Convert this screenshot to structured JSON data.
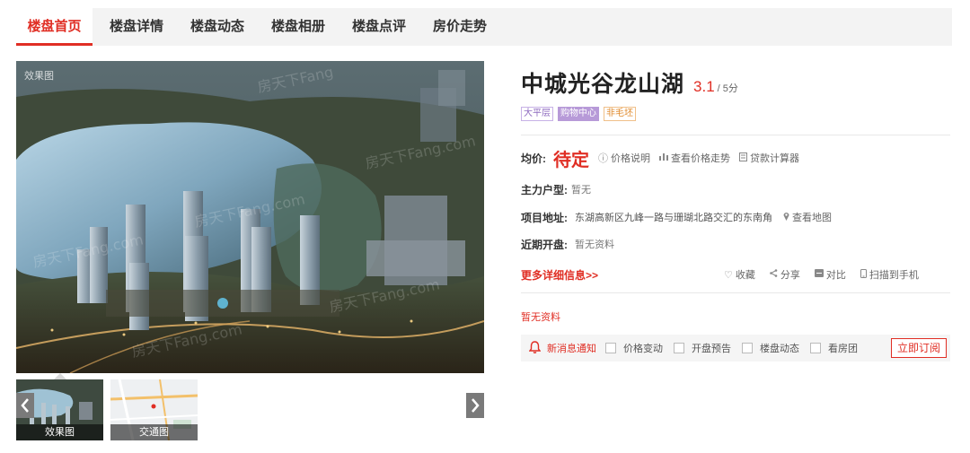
{
  "nav": {
    "tabs": [
      {
        "label": "楼盘首页",
        "active": true
      },
      {
        "label": "楼盘详情",
        "active": false
      },
      {
        "label": "楼盘动态",
        "active": false
      },
      {
        "label": "楼盘相册",
        "active": false
      },
      {
        "label": "楼盘点评",
        "active": false
      },
      {
        "label": "房价走势",
        "active": false
      }
    ]
  },
  "gallery": {
    "main_tag": "效果图",
    "thumbs": [
      {
        "caption": "效果图",
        "selected": true
      },
      {
        "caption": "交通图",
        "selected": false
      }
    ],
    "prev_icon": "chevron-left-icon",
    "next_icon": "chevron-right-icon"
  },
  "info": {
    "title": "中城光谷龙山湖",
    "score": "3.1",
    "score_unit": "/ 5分",
    "tags": [
      "大平层",
      "购物中心",
      "非毛坯"
    ],
    "price_label": "均价:",
    "price_value": "待定",
    "price_links": [
      {
        "label": "价格说明",
        "icon": "info-circle-icon"
      },
      {
        "label": "查看价格走势",
        "icon": "bar-chart-icon"
      },
      {
        "label": "贷款计算器",
        "icon": "calculator-icon"
      }
    ],
    "layout_label": "主力户型:",
    "layout_value": "暂无",
    "address_label": "项目地址:",
    "address_value": "东湖高新区九峰一路与珊瑚北路交汇的东南角",
    "map_link": "查看地图",
    "opening_label": "近期开盘:",
    "opening_value": "暂无资料",
    "more_link": "更多详细信息>>",
    "actions": [
      {
        "label": "收藏",
        "icon": "heart-icon"
      },
      {
        "label": "分享",
        "icon": "share-icon"
      },
      {
        "label": "对比",
        "icon": "compare-icon"
      },
      {
        "label": "扫描到手机",
        "icon": "phone-icon"
      }
    ],
    "no_info": "暂无资料"
  },
  "subscribe": {
    "label": "新消息通知",
    "options": [
      "价格变动",
      "开盘预告",
      "楼盘动态",
      "看房团"
    ],
    "button": "立即订阅"
  },
  "colors": {
    "accent": "#e02e24",
    "nav_bg": "#f3f3f3"
  }
}
